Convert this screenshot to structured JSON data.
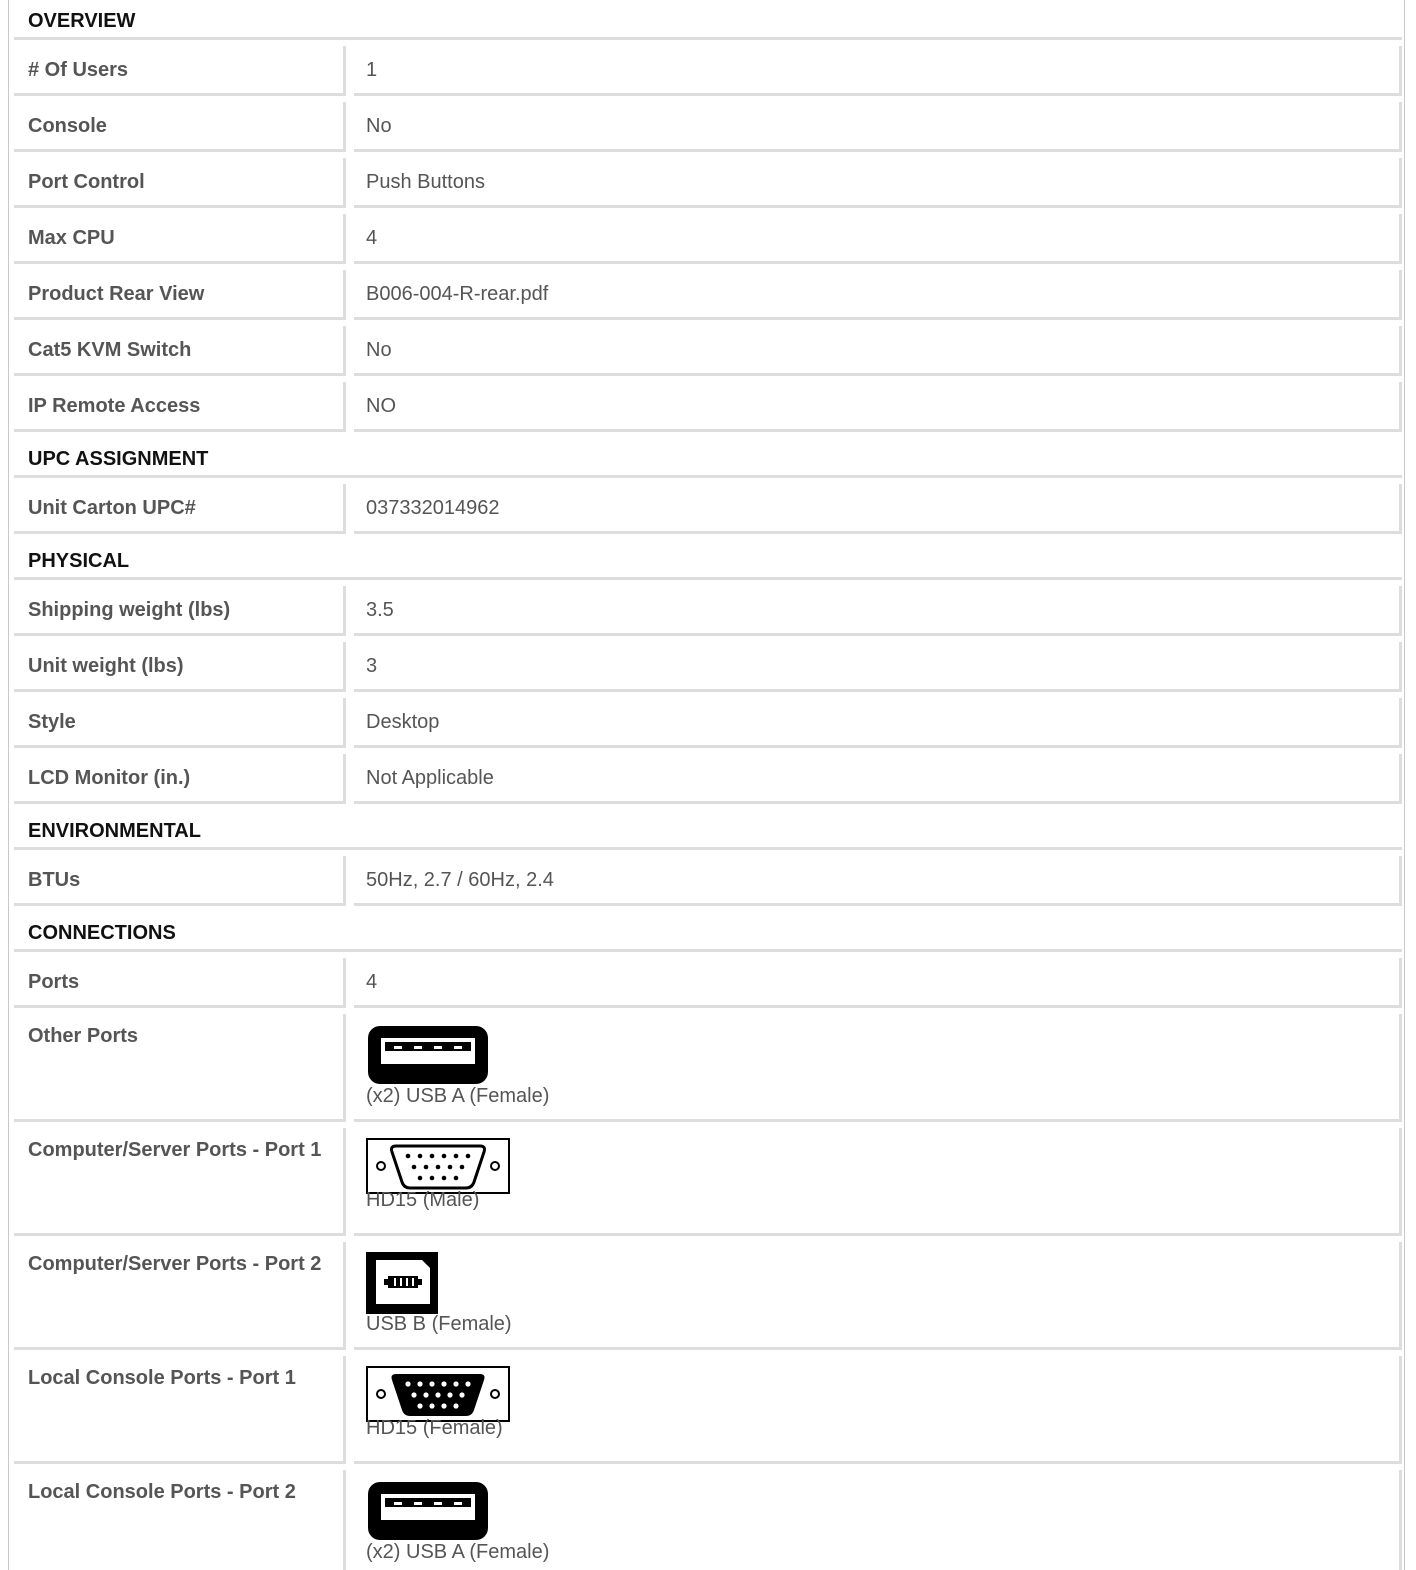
{
  "sections": [
    {
      "title": "OVERVIEW",
      "rows": [
        {
          "label": "# Of Users",
          "value": "1"
        },
        {
          "label": "Console",
          "value": "No"
        },
        {
          "label": "Port Control",
          "value": "Push Buttons"
        },
        {
          "label": "Max CPU",
          "value": "4"
        },
        {
          "label": "Product Rear View",
          "value": "B006-004-R-rear.pdf"
        },
        {
          "label": "Cat5 KVM Switch",
          "value": "No"
        },
        {
          "label": "IP Remote Access",
          "value": "NO"
        }
      ]
    },
    {
      "title": "UPC ASSIGNMENT",
      "rows": [
        {
          "label": "Unit Carton UPC#",
          "value": "037332014962"
        }
      ]
    },
    {
      "title": "PHYSICAL",
      "rows": [
        {
          "label": "Shipping weight (lbs)",
          "value": "3.5"
        },
        {
          "label": "Unit weight (lbs)",
          "value": "3"
        },
        {
          "label": "Style",
          "value": "Desktop"
        },
        {
          "label": "LCD Monitor (in.)",
          "value": "Not Applicable"
        }
      ]
    },
    {
      "title": "ENVIRONMENTAL",
      "rows": [
        {
          "label": "BTUs",
          "value": "50Hz, 2.7 / 60Hz, 2.4"
        }
      ]
    },
    {
      "title": "CONNECTIONS",
      "rows": [
        {
          "label": "Ports",
          "value": "4"
        },
        {
          "label": "Other Ports",
          "value": "(x2) USB A (Female)",
          "icon": "usb-a-female-icon"
        },
        {
          "label": "Computer/Server Ports - Port 1",
          "value": "HD15 (Male)",
          "icon": "hd15-male-icon"
        },
        {
          "label": "Computer/Server Ports - Port 2",
          "value": "USB B (Female)",
          "icon": "usb-b-female-icon"
        },
        {
          "label": "Local Console Ports - Port 1",
          "value": "HD15 (Female)",
          "icon": "hd15-female-icon"
        },
        {
          "label": "Local Console Ports - Port 2",
          "value": "(x2) USB A (Female)",
          "icon": "usb-a-female-icon"
        }
      ]
    }
  ]
}
